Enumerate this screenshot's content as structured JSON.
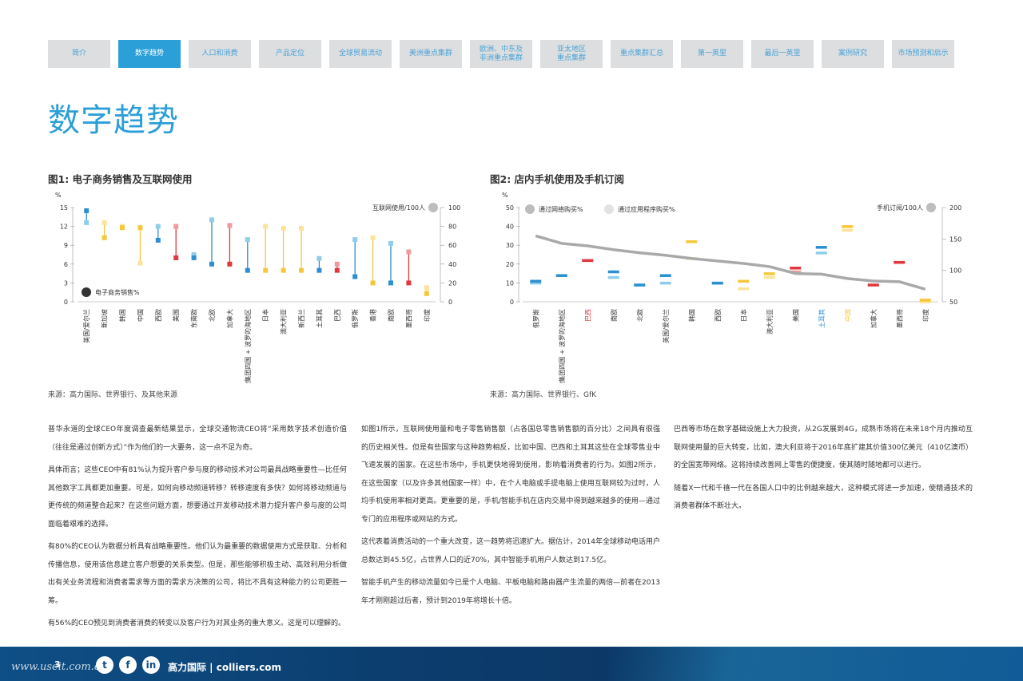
{
  "nav": {
    "tabs": [
      {
        "label": "简介",
        "active": false
      },
      {
        "label": "数字趋势",
        "active": true
      },
      {
        "label": "人口和消费",
        "active": false
      },
      {
        "label": "产品定位",
        "active": false
      },
      {
        "label": "全球贸易流动",
        "active": false
      },
      {
        "label": "美洲重点集群",
        "active": false
      },
      {
        "label": "欧洲、中东及\n非洲重点集群",
        "active": false
      },
      {
        "label": "亚太地区\n重点集群",
        "active": false
      },
      {
        "label": "重点集群汇总",
        "active": false
      },
      {
        "label": "第一英里",
        "active": false
      },
      {
        "label": "最后一英里",
        "active": false
      },
      {
        "label": "案例研究",
        "active": false
      },
      {
        "label": "市场预测和启示",
        "active": false
      }
    ]
  },
  "page_title": "数字趋势",
  "figure1": {
    "title": "图1: 电子商务销售及互联网使用",
    "source": "来源：高力国际、世界银行、及其他来源"
  },
  "figure2": {
    "title": "图2: 店内手机使用及手机订阅",
    "source": "来源：高力国际、世界银行、GfK"
  },
  "chart_data": [
    {
      "type": "dumbbell",
      "title": "图1: 电子商务销售及互联网使用",
      "y_left_unit": "%",
      "y_left_ticks": [
        0,
        3,
        6,
        9,
        12,
        15
      ],
      "ylim_left": [
        0,
        15
      ],
      "y_right_ticks": [
        0,
        20,
        40,
        60,
        80,
        100
      ],
      "ylim_right": [
        0,
        100
      ],
      "legend": {
        "right": "互联网使用/100人",
        "left": "电子商务销售%"
      },
      "categories": [
        "英国/爱尔兰",
        "新加坡",
        "韩国",
        "中国",
        "西欧",
        "美国",
        "东南欧",
        "北欧",
        "加拿大",
        "维谢格拉德集团四国 + 波罗的海地区",
        "日本",
        "澳大利亚",
        "新西兰",
        "土耳其",
        "巴西",
        "俄罗斯",
        "香港",
        "南欧",
        "墨西哥",
        "印度"
      ],
      "ecommerce_pct": [
        14.5,
        10.2,
        11.8,
        11.8,
        9.8,
        7.0,
        7.0,
        6.0,
        6.0,
        5.0,
        5.0,
        5.0,
        5.0,
        5.0,
        5.0,
        4.0,
        3.0,
        3.0,
        3.0,
        1.3
      ],
      "internet_per100": [
        84,
        84,
        80,
        41,
        80,
        80,
        50,
        87,
        81,
        66,
        80,
        78,
        78,
        46,
        40,
        66,
        68,
        62,
        53,
        15
      ],
      "bar_colors": [
        "#2b8fd0",
        "#f7c73b",
        "#f7c73b",
        "#f7c73b",
        "#2b8fd0",
        "#e0383e",
        "#2b8fd0",
        "#2b8fd0",
        "#e0383e",
        "#2b8fd0",
        "#f7c73b",
        "#f7c73b",
        "#f7c73b",
        "#2b8fd0",
        "#e0383e",
        "#2b8fd0",
        "#f7c73b",
        "#2b8fd0",
        "#e0383e",
        "#f7c73b"
      ]
    },
    {
      "type": "bar+line",
      "title": "图2: 店内手机使用及手机订阅",
      "y_left_unit": "%",
      "y_left_ticks": [
        0,
        10,
        20,
        30,
        40,
        50
      ],
      "ylim_left": [
        0,
        50
      ],
      "y_right_ticks": [
        50,
        100,
        150,
        200
      ],
      "ylim_right": [
        50,
        200
      ],
      "legend": {
        "web": "通过网络购买%",
        "app": "通过应用程序购买%",
        "line": "手机订阅/100人"
      },
      "categories": [
        "俄罗斯",
        "维谢格拉德集团四国 + 波罗的海地区",
        "巴西",
        "南欧",
        "北欧",
        "英国/爱尔兰",
        "韩国",
        "西欧",
        "日本",
        "澳大利亚",
        "美国",
        "土耳其",
        "中国",
        "加拿大",
        "墨西哥",
        "印度"
      ],
      "label_colors": [
        "#333333",
        "#333333",
        "#e0383e",
        "#333333",
        "#333333",
        "#333333",
        "#333333",
        "#333333",
        "#333333",
        "#333333",
        "#333333",
        "#2b8fd0",
        "#f7c73b",
        "#333333",
        "#333333",
        "#333333"
      ],
      "via_web_pct": [
        11,
        14,
        22,
        16,
        9,
        14,
        32,
        10,
        11,
        15,
        18,
        29,
        40,
        9,
        21,
        1
      ],
      "via_app_pct": [
        10,
        14,
        22,
        13,
        9,
        10,
        23,
        10,
        7,
        13,
        16,
        26,
        38,
        9,
        21,
        0
      ],
      "series_colors": [
        "#2b8fd0",
        "#2b8fd0",
        "#e0383e",
        "#2b8fd0",
        "#2b8fd0",
        "#2b8fd0",
        "#f7c73b",
        "#2b8fd0",
        "#f7c73b",
        "#f7c73b",
        "#e0383e",
        "#2b8fd0",
        "#f7c73b",
        "#e0383e",
        "#e0383e",
        "#f7c73b"
      ],
      "mobile_subs_per100": [
        155,
        143,
        139,
        133,
        128,
        124,
        119,
        115,
        111,
        106,
        95,
        94,
        87,
        83,
        82,
        70
      ]
    }
  ],
  "body": {
    "col1": [
      "普华永道的全球CEO年度调查最新结果显示，全球交通物流CEO将“采用数字技术创造价值（往往是通过创新方式）”作为他们的一大要务，这一点不足为奇。",
      "具体而言；这些CEO中有81%认为提升客户参与度的移动技术对公司最具战略重要性—比任何其他数字工具都更加重要。可是，如何向移动频道转移？转移速度有多快？如何将移动频道与更传统的频道整合起来？在这些问题方面，想要通过开发移动技术潜力提升客户参与度的公司面临着艰难的选择。",
      "有80%的CEO认为数据分析具有战略重要性。他们认为最重要的数据使用方式是获取、分析和传播信息，使用该信息建立客户想要的关系类型。但是，那些能够积极主动、高效利用分析做出有关业务流程和消费者需求等方面的需求方决策的公司，将比不具有这种能力的公司更胜一筹。",
      "有56%的CEO预见到消费者消费的转变以及客户行为对其业务的重大意义。这是可以理解的。"
    ],
    "col2": [
      "如图1所示，互联网使用量和电子零售销售额（占各国总零售销售额的百分比）之间具有很强的历史相关性。但是有些国家与这种趋势相反，比如中国、巴西和土耳其这些在全球零售业中飞速发展的国家。在这些市场中，手机更快地得到使用，影响着消费者的行为。如图2所示，在这些国家（以及许多其他国家一样）中，在个人电脑或手提电脑上使用互联网较为过时，人均手机使用率相对更高。更重要的是，手机/智能手机在店内交易中得到越来越多的使用—通过专门的应用程序或网站的方式。",
      "这代表着消费活动的一个重大改变，这一趋势将迅速扩大。据估计，2014年全球移动电话用户总数达到45.5亿，占世界人口的近70%，其中智能手机用户人数达到17.5亿。",
      "智能手机产生的移动流量如今已是个人电脑、平板电脑和路由器产生流量的两倍—前者在2013年才刚刚超过后者，预计到2019年将增长十倍。"
    ],
    "col3": [
      "巴西等市场在数字基础设施上大力投资，从2G发展到4G，成熟市场将在未来18个月内推动互联网使用量的巨大转变，比如，澳大利亚将于2016年底扩建其价值300亿美元（410亿澳币）的全国宽带网络。这将持续改善网上零售的便捷度，使其随时随地都可以进行。",
      "随着X一代和千禧一代在各国人口中的比例越来越大，这种模式将进一步加速，使精通技术的消费者群体不断壮大。"
    ]
  },
  "footer": {
    "page_number": "3",
    "brand": "高力国际 | colliers.com",
    "watermark": "www.useit.com.cn",
    "social": [
      "twitter-icon",
      "facebook-icon",
      "linkedin-icon"
    ]
  }
}
